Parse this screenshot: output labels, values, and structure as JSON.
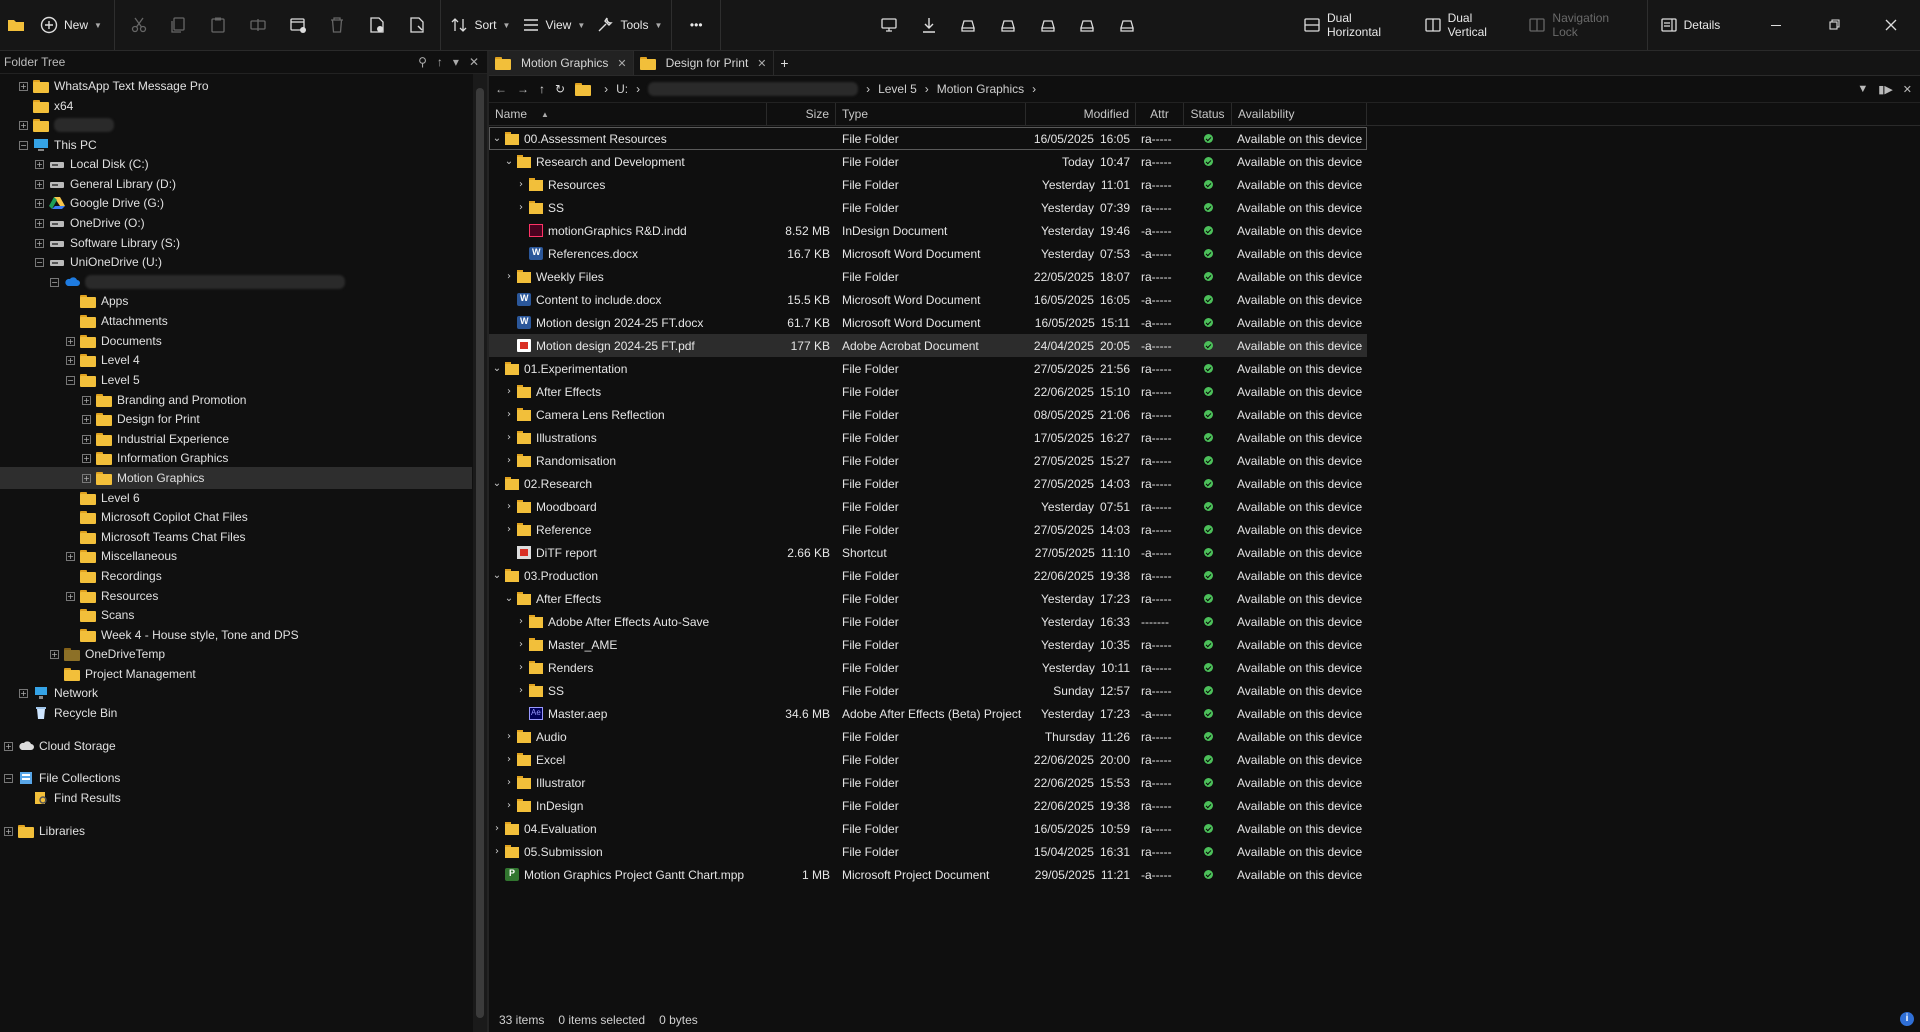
{
  "toolbar": {
    "new_label": "New",
    "sort_label": "Sort",
    "view_label": "View",
    "tools_label": "Tools",
    "more_label": "•••",
    "dual_horizontal_label": "Dual Horizontal",
    "dual_vertical_label": "Dual Vertical",
    "navigation_lock_label": "Navigation Lock",
    "details_label": "Details"
  },
  "tree": {
    "title": "Folder Tree",
    "items": [
      {
        "label": "WhatsApp Text Message Pro"
      },
      {
        "label": "x64"
      },
      {
        "label": ""
      },
      {
        "label": "This PC"
      },
      {
        "label": "Local Disk (C:)"
      },
      {
        "label": "General Library (D:)"
      },
      {
        "label": "Google Drive (G:)"
      },
      {
        "label": "OneDrive (O:)"
      },
      {
        "label": "Software Library (S:)"
      },
      {
        "label": "UniOneDrive (U:)"
      },
      {
        "label": ""
      },
      {
        "label": "Apps"
      },
      {
        "label": "Attachments"
      },
      {
        "label": "Documents"
      },
      {
        "label": "Level 4"
      },
      {
        "label": "Level 5"
      },
      {
        "label": "Branding and Promotion"
      },
      {
        "label": "Design for Print"
      },
      {
        "label": "Industrial Experience"
      },
      {
        "label": "Information Graphics"
      },
      {
        "label": "Motion Graphics"
      },
      {
        "label": "Level 6"
      },
      {
        "label": "Microsoft Copilot Chat Files"
      },
      {
        "label": "Microsoft Teams Chat Files"
      },
      {
        "label": "Miscellaneous"
      },
      {
        "label": "Recordings"
      },
      {
        "label": "Resources"
      },
      {
        "label": "Scans"
      },
      {
        "label": "Week 4 - House style, Tone and DPS"
      },
      {
        "label": "OneDriveTemp"
      },
      {
        "label": "Project Management"
      },
      {
        "label": "Network"
      },
      {
        "label": "Recycle Bin"
      },
      {
        "label": "Cloud Storage"
      },
      {
        "label": "File Collections"
      },
      {
        "label": "Find Results"
      },
      {
        "label": "Libraries"
      }
    ]
  },
  "tabs": [
    {
      "label": "Motion Graphics"
    },
    {
      "label": "Design for Print"
    }
  ],
  "address": {
    "drive": "U:",
    "crumb_level": "Level 5",
    "crumb_current": "Motion Graphics"
  },
  "columns": {
    "name": "Name",
    "size": "Size",
    "type": "Type",
    "modified": "Modified",
    "attr": "Attr",
    "status": "Status",
    "availability": "Availability"
  },
  "files": [
    {
      "name": "00.Assessment Resources",
      "size": "",
      "type": "File Folder",
      "date": "16/05/2025",
      "time": "16:05",
      "attr": "ra-----",
      "avail": "Available on this device"
    },
    {
      "name": "Research and Development",
      "size": "",
      "type": "File Folder",
      "date": "Today",
      "time": "10:47",
      "attr": "ra-----",
      "avail": "Available on this device"
    },
    {
      "name": "Resources",
      "size": "",
      "type": "File Folder",
      "date": "Yesterday",
      "time": "11:01",
      "attr": "ra-----",
      "avail": "Available on this device"
    },
    {
      "name": "SS",
      "size": "",
      "type": "File Folder",
      "date": "Yesterday",
      "time": "07:39",
      "attr": "ra-----",
      "avail": "Available on this device"
    },
    {
      "name": "motionGraphics R&D.indd",
      "size": "8.52 MB",
      "type": "InDesign Document",
      "date": "Yesterday",
      "time": "19:46",
      "attr": "-a-----",
      "avail": "Available on this device"
    },
    {
      "name": "References.docx",
      "size": "16.7 KB",
      "type": "Microsoft Word Document",
      "date": "Yesterday",
      "time": "07:53",
      "attr": "-a-----",
      "avail": "Available on this device"
    },
    {
      "name": "Weekly Files",
      "size": "",
      "type": "File Folder",
      "date": "22/05/2025",
      "time": "18:07",
      "attr": "ra-----",
      "avail": "Available on this device"
    },
    {
      "name": "Content to include.docx",
      "size": "15.5 KB",
      "type": "Microsoft Word Document",
      "date": "16/05/2025",
      "time": "16:05",
      "attr": "-a-----",
      "avail": "Available on this device"
    },
    {
      "name": "Motion design 2024-25 FT.docx",
      "size": "61.7 KB",
      "type": "Microsoft Word Document",
      "date": "16/05/2025",
      "time": "15:11",
      "attr": "-a-----",
      "avail": "Available on this device"
    },
    {
      "name": "Motion design 2024-25 FT.pdf",
      "size": "177 KB",
      "type": "Adobe Acrobat Document",
      "date": "24/04/2025",
      "time": "20:05",
      "attr": "-a-----",
      "avail": "Available on this device"
    },
    {
      "name": "01.Experimentation",
      "size": "",
      "type": "File Folder",
      "date": "27/05/2025",
      "time": "21:56",
      "attr": "ra-----",
      "avail": "Available on this device"
    },
    {
      "name": "After Effects",
      "size": "",
      "type": "File Folder",
      "date": "22/06/2025",
      "time": "15:10",
      "attr": "ra-----",
      "avail": "Available on this device"
    },
    {
      "name": "Camera Lens Reflection",
      "size": "",
      "type": "File Folder",
      "date": "08/05/2025",
      "time": "21:06",
      "attr": "ra-----",
      "avail": "Available on this device"
    },
    {
      "name": "Illustrations",
      "size": "",
      "type": "File Folder",
      "date": "17/05/2025",
      "time": "16:27",
      "attr": "ra-----",
      "avail": "Available on this device"
    },
    {
      "name": "Randomisation",
      "size": "",
      "type": "File Folder",
      "date": "27/05/2025",
      "time": "15:27",
      "attr": "ra-----",
      "avail": "Available on this device"
    },
    {
      "name": "02.Research",
      "size": "",
      "type": "File Folder",
      "date": "27/05/2025",
      "time": "14:03",
      "attr": "ra-----",
      "avail": "Available on this device"
    },
    {
      "name": "Moodboard",
      "size": "",
      "type": "File Folder",
      "date": "Yesterday",
      "time": "07:51",
      "attr": "ra-----",
      "avail": "Available on this device"
    },
    {
      "name": "Reference",
      "size": "",
      "type": "File Folder",
      "date": "27/05/2025",
      "time": "14:03",
      "attr": "ra-----",
      "avail": "Available on this device"
    },
    {
      "name": "DiTF report",
      "size": "2.66 KB",
      "type": "Shortcut",
      "date": "27/05/2025",
      "time": "11:10",
      "attr": "-a-----",
      "avail": "Available on this device"
    },
    {
      "name": "03.Production",
      "size": "",
      "type": "File Folder",
      "date": "22/06/2025",
      "time": "19:38",
      "attr": "ra-----",
      "avail": "Available on this device"
    },
    {
      "name": "After Effects",
      "size": "",
      "type": "File Folder",
      "date": "Yesterday",
      "time": "17:23",
      "attr": "ra-----",
      "avail": "Available on this device"
    },
    {
      "name": "Adobe After Effects Auto-Save",
      "size": "",
      "type": "File Folder",
      "date": "Yesterday",
      "time": "16:33",
      "attr": "-------",
      "avail": "Available on this device"
    },
    {
      "name": "Master_AME",
      "size": "",
      "type": "File Folder",
      "date": "Yesterday",
      "time": "10:35",
      "attr": "ra-----",
      "avail": "Available on this device"
    },
    {
      "name": "Renders",
      "size": "",
      "type": "File Folder",
      "date": "Yesterday",
      "time": "10:11",
      "attr": "ra-----",
      "avail": "Available on this device"
    },
    {
      "name": "SS",
      "size": "",
      "type": "File Folder",
      "date": "Sunday",
      "time": "12:57",
      "attr": "ra-----",
      "avail": "Available on this device"
    },
    {
      "name": "Master.aep",
      "size": "34.6 MB",
      "type": "Adobe After Effects (Beta) Project",
      "date": "Yesterday",
      "time": "17:23",
      "attr": "-a-----",
      "avail": "Available on this device"
    },
    {
      "name": "Audio",
      "size": "",
      "type": "File Folder",
      "date": "Thursday",
      "time": "11:26",
      "attr": "ra-----",
      "avail": "Available on this device"
    },
    {
      "name": "Excel",
      "size": "",
      "type": "File Folder",
      "date": "22/06/2025",
      "time": "20:00",
      "attr": "ra-----",
      "avail": "Available on this device"
    },
    {
      "name": "Illustrator",
      "size": "",
      "type": "File Folder",
      "date": "22/06/2025",
      "time": "15:53",
      "attr": "ra-----",
      "avail": "Available on this device"
    },
    {
      "name": "InDesign",
      "size": "",
      "type": "File Folder",
      "date": "22/06/2025",
      "time": "19:38",
      "attr": "ra-----",
      "avail": "Available on this device"
    },
    {
      "name": "04.Evaluation",
      "size": "",
      "type": "File Folder",
      "date": "16/05/2025",
      "time": "10:59",
      "attr": "ra-----",
      "avail": "Available on this device"
    },
    {
      "name": "05.Submission",
      "size": "",
      "type": "File Folder",
      "date": "15/04/2025",
      "time": "16:31",
      "attr": "ra-----",
      "avail": "Available on this device"
    },
    {
      "name": "Motion Graphics Project Gantt Chart.mpp",
      "size": "1 MB",
      "type": "Microsoft Project Document",
      "date": "29/05/2025",
      "time": "11:21",
      "attr": "-a-----",
      "avail": "Available on this device"
    }
  ],
  "status_bar": {
    "items_count": "33 items",
    "items_selected": "0  items selected",
    "bytes": "0 bytes"
  },
  "colors": {
    "background": "#0f0f0f",
    "folder": "#f2bf3a",
    "status_ok": "#4cc05a",
    "info_blue": "#2f6fd6"
  }
}
